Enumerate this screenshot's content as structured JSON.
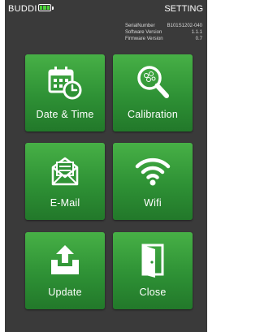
{
  "header": {
    "app_name": "BUDDI",
    "title": "SETTING",
    "battery_icon": "battery-full-icon"
  },
  "info": {
    "serial_label": "SerialNumber",
    "serial_value": "B101S1202-040",
    "software_label": "Software Version",
    "software_value": "1.1.1",
    "firmware_label": "Firmware Version",
    "firmware_value": "0.7"
  },
  "tiles": [
    {
      "label": "Date & Time",
      "icon": "calendar-clock-icon"
    },
    {
      "label": "Calibration",
      "icon": "magnifier-icon"
    },
    {
      "label": "E-Mail",
      "icon": "envelope-icon"
    },
    {
      "label": "Wifi",
      "icon": "wifi-icon"
    },
    {
      "label": "Update",
      "icon": "upload-icon"
    },
    {
      "label": "Close",
      "icon": "door-icon"
    }
  ],
  "colors": {
    "background": "#3a3a3a",
    "tile_green": "#2e9135",
    "battery_green": "#4cd13a"
  }
}
